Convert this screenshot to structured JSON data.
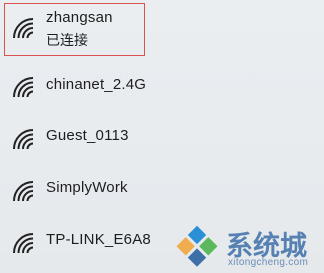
{
  "networks": [
    {
      "name": "zhangsan",
      "status": "已连接",
      "icon": "wifi-signal-icon"
    },
    {
      "name": "chinanet_2.4G",
      "icon": "wifi-signal-icon"
    },
    {
      "name": "Guest_0113",
      "icon": "wifi-signal-icon"
    },
    {
      "name": "SimplyWork",
      "icon": "wifi-signal-icon"
    },
    {
      "name": "TP-LINK_E6A8",
      "icon": "wifi-signal-icon"
    }
  ],
  "watermark": {
    "text": "系统城",
    "url": "xitongcheng.com",
    "logo": "windows-logo"
  },
  "colors": {
    "highlight_border": "#d9534f",
    "watermark_blue": "#3d6fa8"
  }
}
